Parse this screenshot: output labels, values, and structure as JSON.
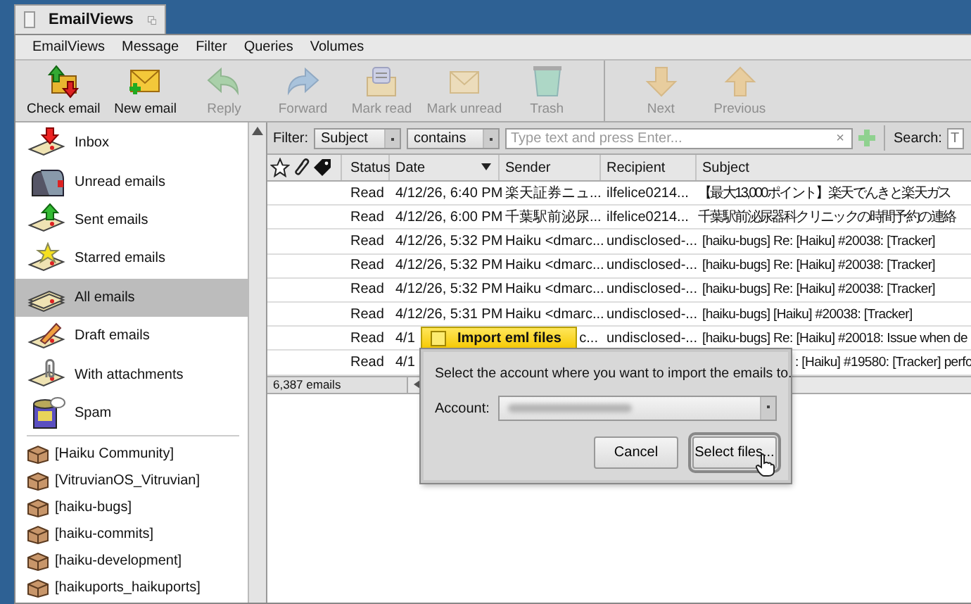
{
  "window": {
    "title": "EmailViews"
  },
  "menu": [
    "EmailViews",
    "Message",
    "Filter",
    "Queries",
    "Volumes"
  ],
  "toolbar": [
    {
      "kind": "check",
      "label": "Check email",
      "disabled": false
    },
    {
      "kind": "new",
      "label": "New email",
      "disabled": false
    },
    {
      "kind": "reply",
      "label": "Reply",
      "disabled": true
    },
    {
      "kind": "forward",
      "label": "Forward",
      "disabled": true
    },
    {
      "kind": "mark-read",
      "label": "Mark read",
      "disabled": true
    },
    {
      "kind": "mark-unread",
      "label": "Mark unread",
      "disabled": true
    },
    {
      "kind": "trash",
      "label": "Trash",
      "disabled": true
    },
    {
      "kind": "next",
      "label": "Next",
      "disabled": true
    },
    {
      "kind": "previous",
      "label": "Previous",
      "disabled": true
    }
  ],
  "sidebar": {
    "items": [
      {
        "kind": "inbox",
        "label": "Inbox",
        "selected": false
      },
      {
        "kind": "unread",
        "label": "Unread emails",
        "selected": false
      },
      {
        "kind": "sent",
        "label": "Sent emails",
        "selected": false
      },
      {
        "kind": "starred",
        "label": "Starred emails",
        "selected": false
      },
      {
        "kind": "all",
        "label": "All emails",
        "selected": true
      },
      {
        "kind": "draft",
        "label": "Draft emails",
        "selected": false
      },
      {
        "kind": "attachments",
        "label": "With attachments",
        "selected": false
      },
      {
        "kind": "spam",
        "label": "Spam",
        "selected": false
      }
    ],
    "folders": [
      {
        "label": "[Haiku Community]",
        "selected": false
      },
      {
        "label": "[VitruvianOS_Vitruvian]",
        "selected": false
      },
      {
        "label": "[haiku-bugs]",
        "selected": false
      },
      {
        "label": "[haiku-commits]",
        "selected": false
      },
      {
        "label": "[haiku-development]",
        "selected": false
      },
      {
        "label": "[haikuports_haikuports]",
        "selected": false
      }
    ]
  },
  "filter": {
    "label": "Filter:",
    "field": "Subject",
    "operator": "contains",
    "placeholder": "Type text and press Enter...",
    "clear": "×"
  },
  "search": {
    "label": "Search:",
    "placeholder": "T"
  },
  "table": {
    "columns": [
      "Status",
      "Date",
      "Sender",
      "Recipient",
      "Subject"
    ],
    "rows": [
      {
        "status": "Read",
        "date": "4/12/26, 6:40 PM",
        "sender": "楽天証券ニュ...",
        "recipient": "ilfelice0214...",
        "subject": "【最大13,000ポイント】楽天でんきと楽天ガス"
      },
      {
        "status": "Read",
        "date": "4/12/26, 6:00 PM",
        "sender": "千葉駅前泌尿...",
        "recipient": "ilfelice0214...",
        "subject": "千葉駅前泌尿器科クリニックの時間予約の連絡"
      },
      {
        "status": "Read",
        "date": "4/12/26, 5:32 PM",
        "sender": "Haiku <dmarc...",
        "recipient": "undisclosed-...",
        "subject": "[haiku-bugs] Re: [Haiku] #20038: [Tracker]"
      },
      {
        "status": "Read",
        "date": "4/12/26, 5:32 PM",
        "sender": "Haiku <dmarc...",
        "recipient": "undisclosed-...",
        "subject": "[haiku-bugs] Re: [Haiku] #20038: [Tracker]"
      },
      {
        "status": "Read",
        "date": "4/12/26, 5:32 PM",
        "sender": "Haiku <dmarc...",
        "recipient": "undisclosed-...",
        "subject": "[haiku-bugs] Re: [Haiku] #20038: [Tracker]"
      },
      {
        "status": "Read",
        "date": "4/12/26, 5:31 PM",
        "sender": "Haiku <dmarc...",
        "recipient": "undisclosed-...",
        "subject": "[haiku-bugs] [Haiku] #20038: [Tracker]"
      },
      {
        "status": "Read",
        "date": "4/1",
        "sender": "c...",
        "recipient": "undisclosed-...",
        "subject": "[haiku-bugs] Re: [Haiku] #20018: Issue when de",
        "covered": true
      },
      {
        "status": "Read",
        "date": "4/1",
        "subject": ": [Haiku] #19580: [Tracker] perfo",
        "covered": true
      }
    ]
  },
  "status_bar": {
    "count": "6,387 emails"
  },
  "dialog": {
    "title": "Import eml files",
    "message": "Select the account where you want to import the emails to.",
    "account_label": "Account:",
    "buttons": [
      {
        "label": "Cancel",
        "default": false
      },
      {
        "label": "Select files...",
        "default": true
      }
    ]
  }
}
